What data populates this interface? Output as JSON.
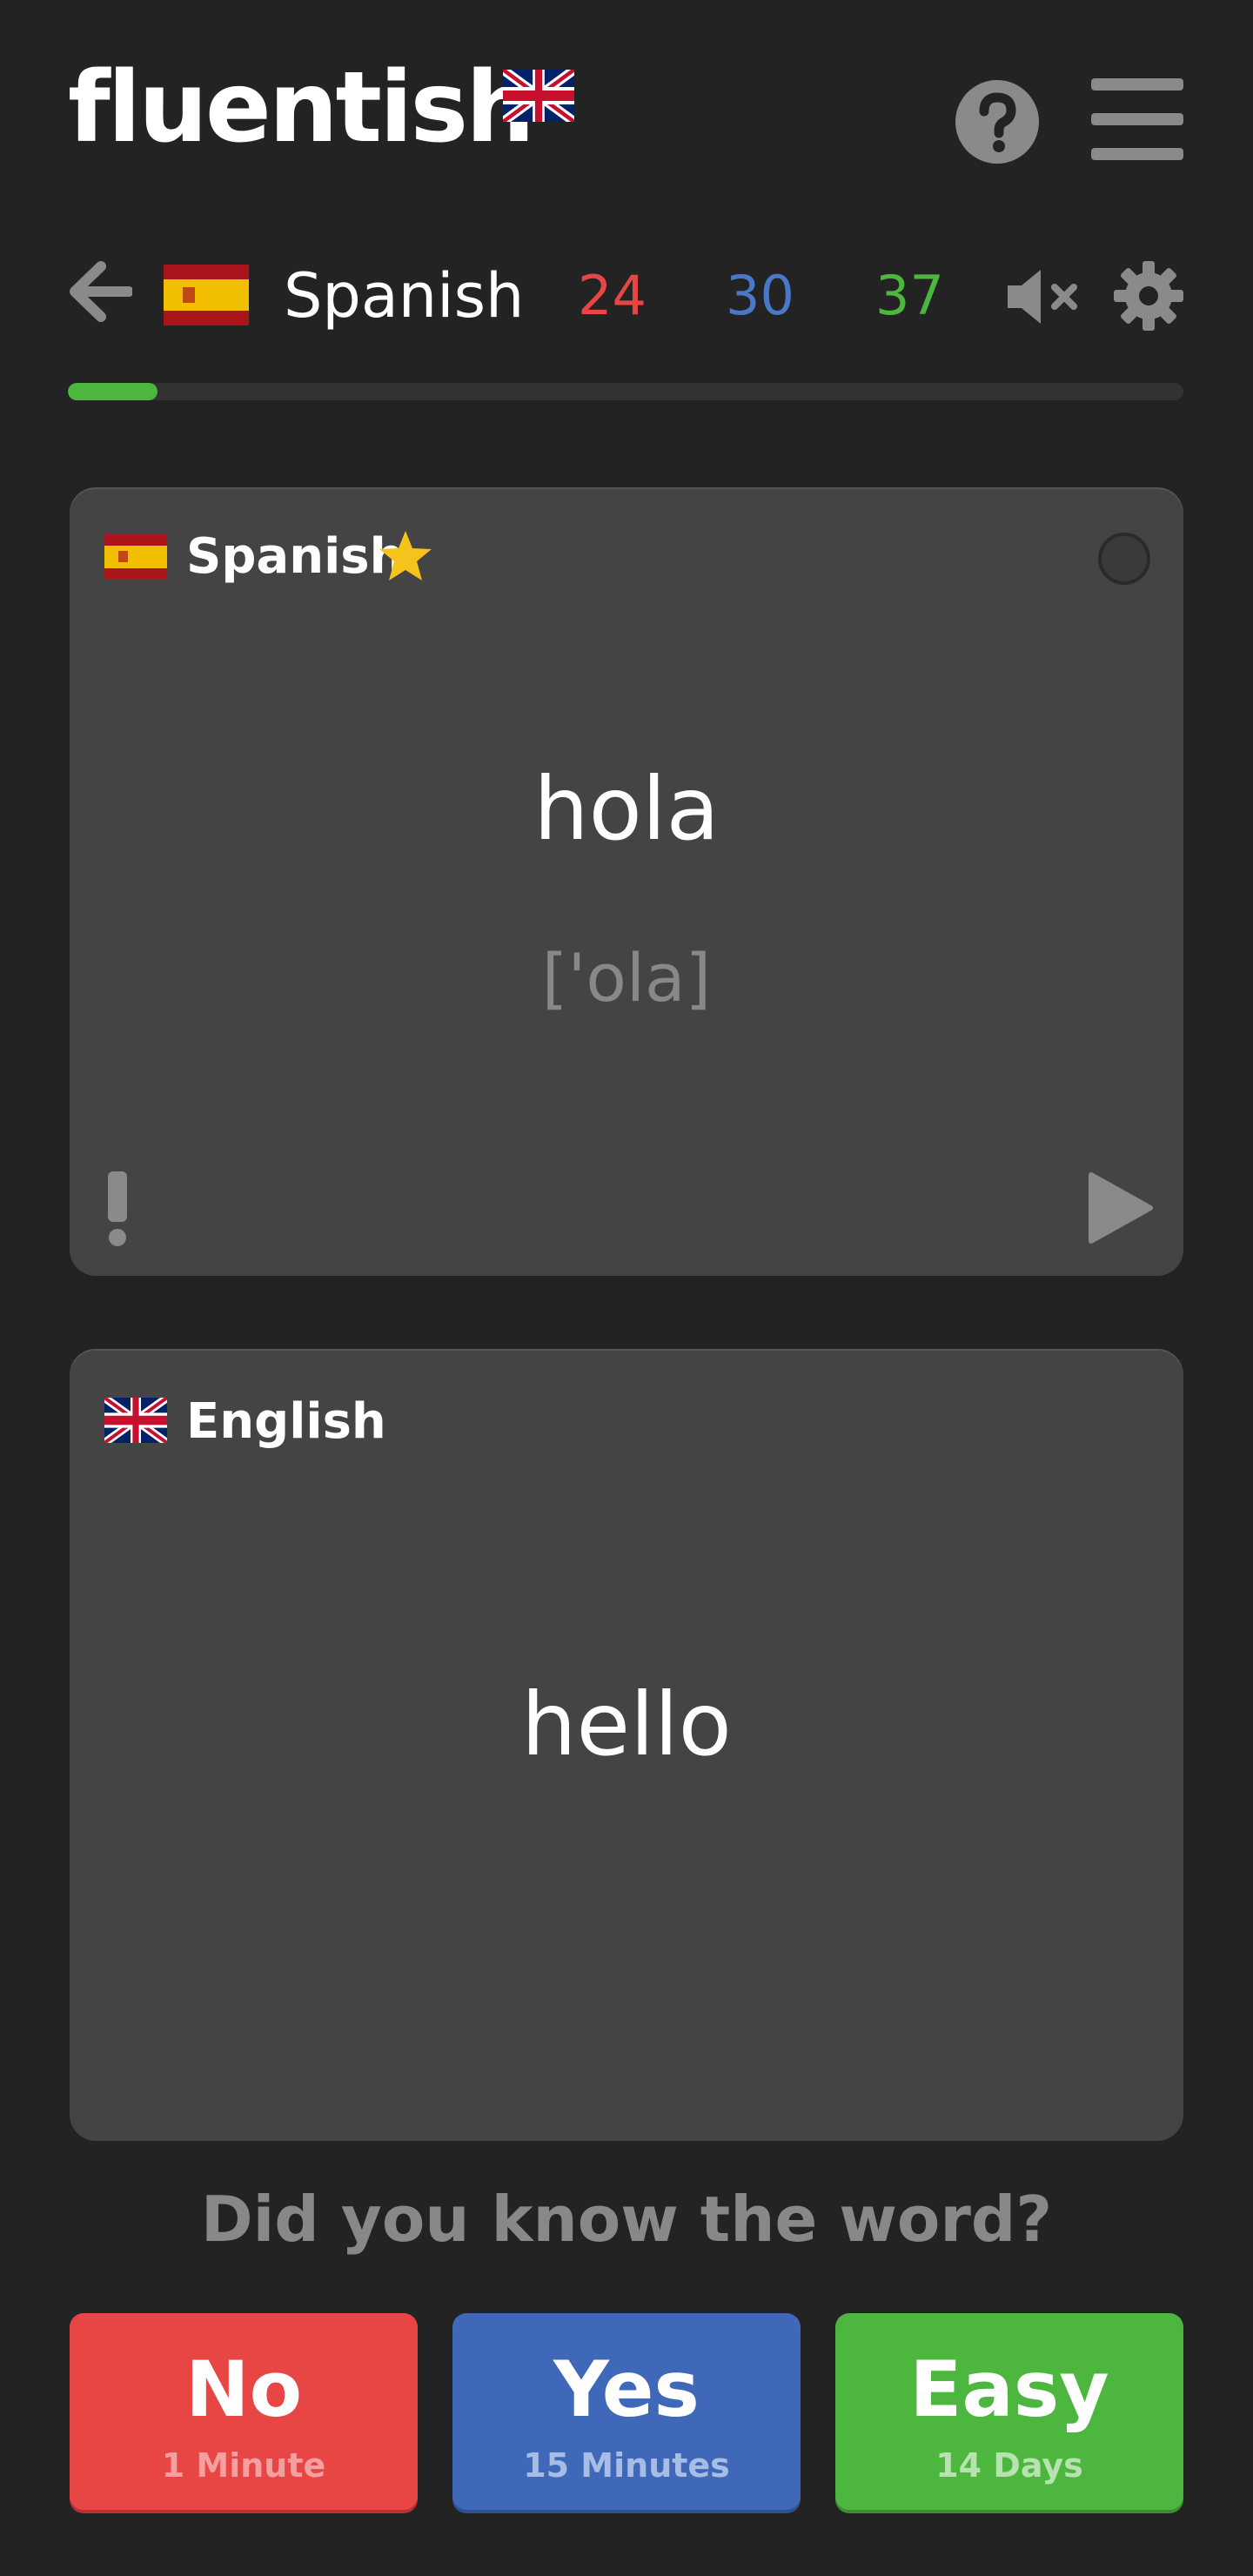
{
  "header": {
    "logo_text": "fluentish"
  },
  "nav": {
    "language": "Spanish",
    "counts": {
      "red": "24",
      "blue": "30",
      "green": "37"
    },
    "progress_fraction": 0.08
  },
  "card_source": {
    "language": "Spanish",
    "word": "hola",
    "phonetic": "['ola]"
  },
  "card_target": {
    "language": "English",
    "word": "hello"
  },
  "prompt": {
    "question": "Did you know the word?"
  },
  "answers": {
    "no": {
      "label": "No",
      "interval": "1 Minute"
    },
    "yes": {
      "label": "Yes",
      "interval": "15 Minutes"
    },
    "easy": {
      "label": "Easy",
      "interval": "14 Days"
    }
  },
  "colors": {
    "background": "#232323",
    "card": "#444444",
    "red": "#e84545",
    "blue": "#3f69b8",
    "green": "#4cb63f",
    "star": "#f6c21c"
  },
  "icons": [
    "uk-flag-icon",
    "help-icon",
    "menu-icon",
    "back-arrow-icon",
    "spain-flag-icon",
    "mute-icon",
    "gear-icon",
    "star-icon",
    "report-icon",
    "play-icon"
  ]
}
